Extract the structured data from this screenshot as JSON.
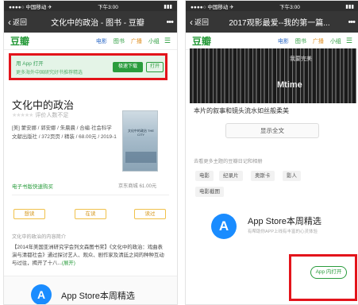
{
  "left": {
    "status": {
      "carrier": "●●●●○ 中国移动 ✈",
      "time": "下午3:00",
      "battery": "▮▮▮"
    },
    "titlebar": {
      "back": "返回",
      "title": "文化中的政治 - 图书 - 豆瓣",
      "more": "•••"
    },
    "nav": {
      "logo": "豆瓣",
      "items": [
        "电影",
        "图书",
        "广播",
        "小组"
      ],
      "menu_icon": "menu-icon"
    },
    "banner": {
      "line1": "用 App 打开",
      "line2": "更多海外中国研究好书推荐精选",
      "download": "极速下载",
      "open": "打开"
    },
    "book": {
      "title": "文化中的政治",
      "rating_text": "评价人数不足",
      "meta": "[美] 蒙安娜 / 郭安娜 / 朱晨晨 / 合编·社会科学文献出版社 / 372页页 / 精装 / 68.00元 / 2019-1",
      "cover_text": "文化中的政治 THE CITY"
    },
    "ebook": {
      "label": "电子书版快速购买",
      "price": "京东商城 61.00元"
    },
    "buttons": [
      "想读",
      "在读",
      "读过"
    ],
    "intro_title": "文化中的政治的内容简介",
    "intro": "【2014年美国亚洲研究学会列文森图书奖】《文化中的政治：戏曲表演与清都社会》通过探讨艺人、观众、剧作家及清廷之间的种种互动与过往，揭开了十八...",
    "intro_more": "(展开)",
    "appstore": {
      "title": "App Store本周精选"
    }
  },
  "right": {
    "status": {
      "carrier": "●●●●○ 中国移动 ✈",
      "time": "下午3:00",
      "battery": "▮▮▮"
    },
    "titlebar": {
      "back": "返回",
      "title": "2017观影最爱--我的第一篇...",
      "more": "•••"
    },
    "nav": {
      "logo": "豆瓣",
      "items": [
        "电影",
        "图书",
        "广播",
        "小组"
      ],
      "menu_icon": "menu-icon"
    },
    "photo_caption": "Mtime",
    "photo_small": "我要完美",
    "caption": "本片的叙事和镜头流水如丝般柔美",
    "full_text_button": "显示全文",
    "tags_title": "去看更多主题的豆瓣日记和相册",
    "tags": [
      "电影",
      "纪录片",
      "奥斯卡",
      "影人",
      "电影截图"
    ],
    "appstore": {
      "title": "App Store本周精选",
      "subtitle": "有帮助你APP上线有丰富的心灵体验",
      "open": "App 内打开"
    }
  }
}
